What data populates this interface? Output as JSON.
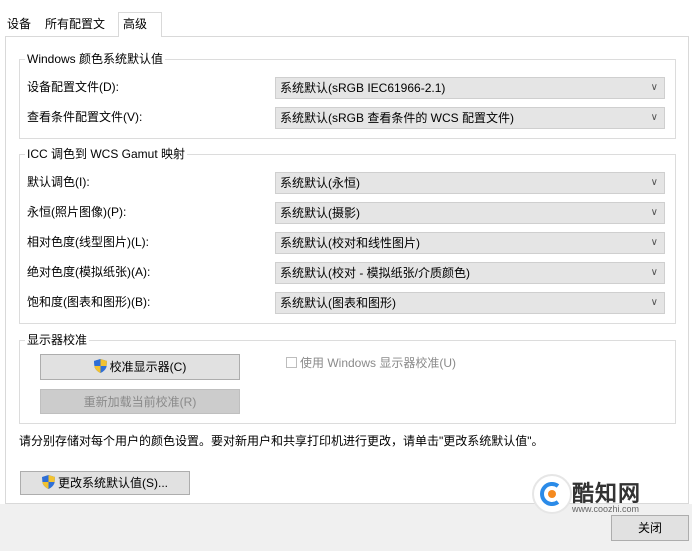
{
  "tabs": [
    {
      "label": "设备"
    },
    {
      "label": "所有配置文件"
    },
    {
      "label": "高级"
    }
  ],
  "group_defaults": {
    "title": "Windows 颜色系统默认值",
    "rows": [
      {
        "label": "设备配置文件(D):",
        "value": "系统默认(sRGB IEC61966-2.1)"
      },
      {
        "label": "查看条件配置文件(V):",
        "value": "系统默认(sRGB 查看条件的 WCS 配置文件)"
      }
    ]
  },
  "group_gamut": {
    "title": "ICC 调色到 WCS Gamut 映射",
    "rows": [
      {
        "label": "默认调色(I):",
        "value": "系统默认(永恒)"
      },
      {
        "label": "永恒(照片图像)(P):",
        "value": "系统默认(摄影)"
      },
      {
        "label": "相对色度(线型图片)(L):",
        "value": "系统默认(校对和线性图片)"
      },
      {
        "label": "绝对色度(模拟纸张)(A):",
        "value": "系统默认(校对 - 模拟纸张/介质颜色)"
      },
      {
        "label": "饱和度(图表和图形)(B):",
        "value": "系统默认(图表和图形)"
      }
    ]
  },
  "group_calibration": {
    "title": "显示器校准",
    "calibrate_button": "校准显示器(C)",
    "reload_button": "重新加载当前校准(R)",
    "use_windows_calibration": {
      "label": "使用 Windows 显示器校准(U)",
      "checked": false
    }
  },
  "info_text": "请分别存储对每个用户的颜色设置。要对新用户和共享打印机进行更改，请单击\"更改系统默认值\"。",
  "change_defaults_button": "更改系统默认值(S)...",
  "close_button": "关闭",
  "watermark": {
    "name": "酷知网",
    "url": "www.coozhi.com"
  },
  "icons": {
    "shield": "uac-shield-icon",
    "chevron": "chevron-down-icon"
  }
}
